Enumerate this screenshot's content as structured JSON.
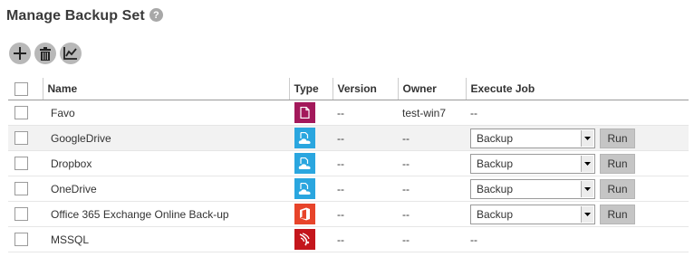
{
  "page": {
    "title": "Manage Backup Set",
    "help_glyph": "?"
  },
  "toolbar": {
    "buttons": [
      {
        "icon": "add-icon"
      },
      {
        "icon": "trash-icon"
      },
      {
        "icon": "chart-icon"
      }
    ]
  },
  "table": {
    "headers": {
      "name": "Name",
      "type": "Type",
      "version": "Version",
      "owner": "Owner",
      "execute_job": "Execute Job"
    },
    "rows": [
      {
        "name": "Favo",
        "type_icon": "file-icon",
        "type_color": "#a3195b",
        "version": "--",
        "owner": "test-win7",
        "job": "--",
        "has_job": false
      },
      {
        "name": "GoogleDrive",
        "type_icon": "cloud-file-icon",
        "type_color": "#2aa6df",
        "version": "--",
        "owner": "--",
        "job": "Backup",
        "run_label": "Run",
        "has_job": true
      },
      {
        "name": "Dropbox",
        "type_icon": "cloud-file-icon",
        "type_color": "#2aa6df",
        "version": "--",
        "owner": "--",
        "job": "Backup",
        "run_label": "Run",
        "has_job": true
      },
      {
        "name": "OneDrive",
        "type_icon": "cloud-file-icon",
        "type_color": "#2aa6df",
        "version": "--",
        "owner": "--",
        "job": "Backup",
        "run_label": "Run",
        "has_job": true
      },
      {
        "name": "Office 365 Exchange Online Back-up",
        "type_icon": "office365-icon",
        "type_color": "#e7442a",
        "version": "--",
        "owner": "--",
        "job": "Backup",
        "run_label": "Run",
        "has_job": true
      },
      {
        "name": "MSSQL",
        "type_icon": "mssql-icon",
        "type_color": "#c4161c",
        "version": "--",
        "owner": "--",
        "job": "--",
        "has_job": false
      }
    ]
  }
}
